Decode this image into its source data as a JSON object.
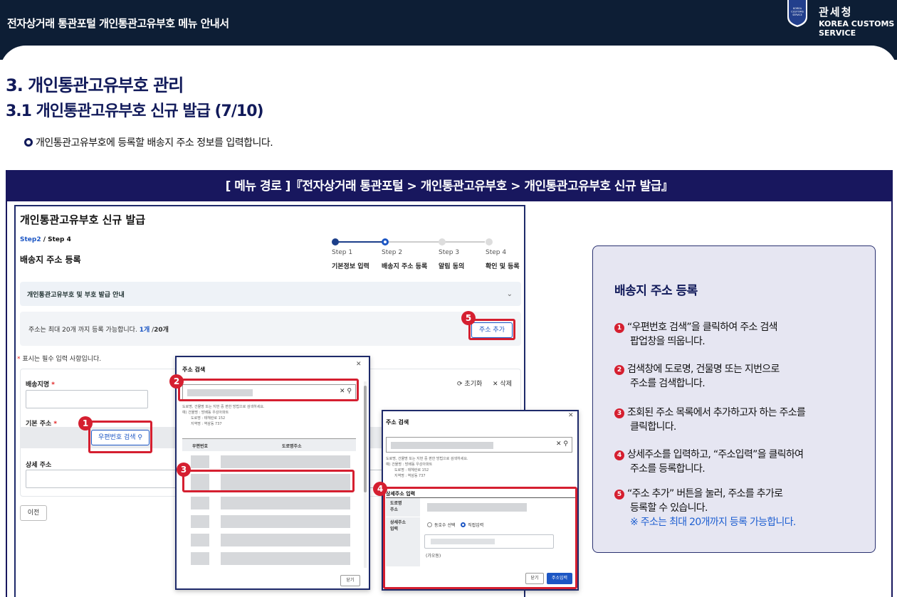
{
  "banner": {
    "title": "전자상거래 통관포털 개인통관고유부호 메뉴 안내서",
    "org_ko": "관세청",
    "org_en_1": "KOREA CUSTOMS",
    "org_en_2": "SERVICE",
    "emblem_text_1": "KOREA",
    "emblem_text_2": "CUSTOMS",
    "emblem_text_3": "SERVICE"
  },
  "headings": {
    "h1": "3. 개인통관고유부호 관리",
    "h2": "3.1 개인통관고유부호 신규 발급 (7/10)",
    "bullet": "개인통관고유부호에 등록할 배송지 주소 정보를 입력합니다."
  },
  "frame": {
    "menu_path": "[ 메뉴 경로 ]『전자상거래 통관포털 > 개인통관고유부호 > 개인통관고유부호 신규 발급』"
  },
  "page": {
    "title": "개인통관고유부호 신규 발급",
    "step_current": "Step2",
    "step_total": " / Step 4",
    "subtitle": "배송지 주소 등록",
    "steps": [
      {
        "num": "Step 1",
        "name": "기본정보 입력"
      },
      {
        "num": "Step 2",
        "name": "배송지 주소 등록"
      },
      {
        "num": "Step 3",
        "name": "알림 동의"
      },
      {
        "num": "Step 4",
        "name": "확인 및 등록"
      }
    ],
    "guide_label": "개인통관고유부호 및 부호 발급 안내",
    "count_prefix": "주소는 최대 20개 까지 등록 가능합니다. ",
    "count_current": "1개",
    "count_sep": " /",
    "count_max": "20개",
    "add_button": "주소 추가",
    "required_star": "*",
    "required_note": " 표시는 필수 입력 사항입니다.",
    "field_name_label": "배송지명",
    "field_basic_label": "기본 주소",
    "field_detail_label": "상세 주소",
    "zip_button": "우편번호 검색",
    "reset_link": "초기화",
    "delete_link": "삭제",
    "prev_button": "이전"
  },
  "popup1": {
    "title": "주소 검색",
    "hint_lines": [
      "도로명, 건물명 또는 지번 중 편한 방법으로 검색하세요.",
      "예) 건물명 : 방배동 우성아파트",
      "도로명 : 테헤란로 152",
      "지역명 : 역삼동 737"
    ],
    "col_zip": "우편번호",
    "col_road": "도로명주소",
    "close_button": "닫기"
  },
  "popup2": {
    "title": "주소 검색",
    "hint_lines": [
      "도로명, 건물명 또는 지번 중 편한 방법으로 검색하세요.",
      "예) 건물명 : 방배동 우성아파트",
      "도로명 : 테헤란로 152",
      "지역명 : 역삼동 737"
    ],
    "detail_title": "상세주소 입력",
    "road_label_1": "도로명",
    "road_label_2": "주소",
    "detail_label_1": "상세주소",
    "detail_label_2": "입력",
    "radio_building": "동호수 선택",
    "radio_direct": "직접입력",
    "hint_sample": "(가오동)",
    "close_button": "닫기",
    "submit_button": "주소입력"
  },
  "badges": [
    "1",
    "2",
    "3",
    "4",
    "5"
  ],
  "info": {
    "title": "배송지 주소 등록",
    "items": [
      {
        "num": "1",
        "line1": "“우편번호 검색”을 클릭하여 주소 검색",
        "line2": "팝업창을 띄웁니다."
      },
      {
        "num": "2",
        "line1": "검색창에 도로명, 건물명 또는 지번으로",
        "line2": "주소를 검색합니다."
      },
      {
        "num": "3",
        "line1": "조회된 주소 목록에서 추가하고자 하는 주소를",
        "line2": "클릭합니다."
      },
      {
        "num": "4",
        "line1": "상세주소를 입력하고, “주소입력”을 클릭하여",
        "line2": "주소를 등록합니다."
      },
      {
        "num": "5",
        "line1": "“주소 추가” 버튼을 눌러, 주소를 추가로",
        "line2": "등록할 수 있습니다."
      }
    ],
    "note": "※ 주소는 최대 20개까지 등록 가능합니다."
  },
  "colors": {
    "navy": "#18175e",
    "highlight_red": "#d51f30",
    "link_blue": "#1c56c4",
    "card_bg": "#e6e6f2"
  }
}
